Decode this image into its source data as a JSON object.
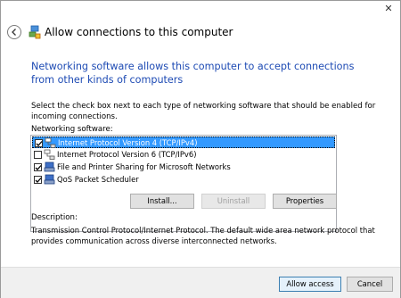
{
  "window": {
    "title": "Allow connections to this computer",
    "close_glyph": "✕"
  },
  "heading": "Networking software allows this computer to accept connections from other kinds of computers",
  "instruction": "Select the check box next to each type of networking software that should be enabled for incoming connections.",
  "list": {
    "label": "Networking software:",
    "items": [
      {
        "label": "Internet Protocol Version 4 (TCP/IPv4)",
        "checked": true,
        "selected": true,
        "icon": "network-protocol-icon"
      },
      {
        "label": "Internet Protocol Version 6 (TCP/IPv6)",
        "checked": false,
        "selected": false,
        "icon": "network-protocol-icon"
      },
      {
        "label": "File and Printer Sharing for Microsoft Networks",
        "checked": true,
        "selected": false,
        "icon": "network-service-icon"
      },
      {
        "label": "QoS Packet Scheduler",
        "checked": true,
        "selected": false,
        "icon": "network-service-icon"
      }
    ]
  },
  "buttons": {
    "install": "Install...",
    "uninstall": "Uninstall",
    "properties": "Properties",
    "allow": "Allow access",
    "cancel": "Cancel"
  },
  "description": {
    "label": "Description:",
    "text": "Transmission Control Protocol/Internet Protocol. The default wide area network protocol that provides communication across diverse interconnected networks."
  },
  "colors": {
    "heading": "#1e4bb4",
    "selection": "#3399ff",
    "footer_bg": "#f0f0f0"
  }
}
